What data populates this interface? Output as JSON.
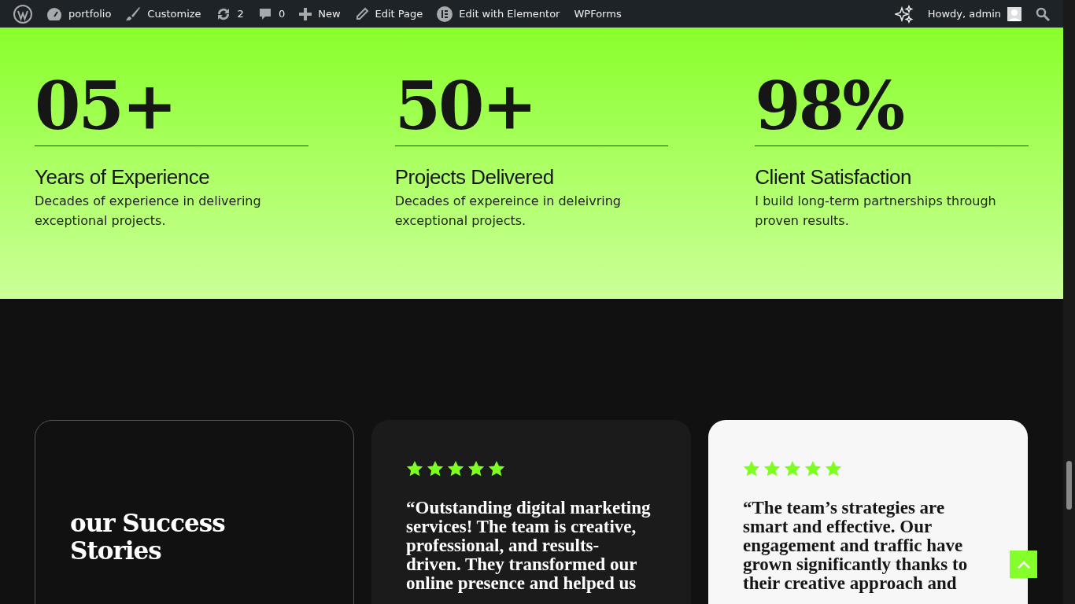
{
  "admin_bar": {
    "items": [
      {
        "label": "portfolio"
      },
      {
        "label": "Customize"
      },
      {
        "label": "2"
      },
      {
        "label": "0"
      },
      {
        "label": "New"
      },
      {
        "label": "Edit Page"
      },
      {
        "label": "Edit with Elementor"
      },
      {
        "label": "WPForms"
      }
    ],
    "greeting": "Howdy, admin"
  },
  "stats": [
    {
      "number": "05+",
      "title": "Years of Experience",
      "text": "Decades of experience in delivering exceptional projects."
    },
    {
      "number": "50+",
      "title": "Projects Delivered",
      "text": "Decades of expereince in deleivring exceptional projects."
    },
    {
      "number": "98%",
      "title": "Client Satisfaction",
      "text": "I build long-term partnerships through proven results."
    }
  ],
  "testimonials": {
    "heading": "our Success Stories",
    "cards": [
      {
        "kind": "dark",
        "stars": 5,
        "quote": "“Outstanding digital marketing services! The team is creative, professional, and results-driven. They transformed our online presence and helped us"
      },
      {
        "kind": "light",
        "stars": 5,
        "quote": "“The team’s strategies are smart and effective. Our engagement and traffic have grown significantly thanks to their creative approach and"
      }
    ]
  }
}
